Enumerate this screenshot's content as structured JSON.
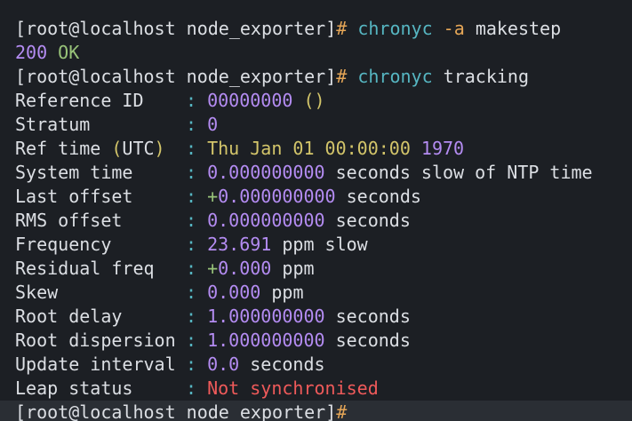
{
  "prompt1": {
    "user_host_dir": "[root@localhost node_exporter]",
    "hash": "#",
    "command": "chronyc",
    "flag": "-a",
    "arg": "makestep"
  },
  "output1": {
    "code": "200",
    "text": "OK"
  },
  "prompt2": {
    "user_host_dir": "[root@localhost node_exporter]",
    "hash": "#",
    "command": "chronyc",
    "arg": "tracking"
  },
  "separator": ":",
  "tracking": {
    "reference_id": {
      "label": "Reference ID",
      "value": "00000000",
      "extra": "()"
    },
    "stratum": {
      "label": "Stratum",
      "value": "0"
    },
    "ref_time": {
      "label_pre": "Ref time ",
      "label_paren_open": "(",
      "label_utc": "UTC",
      "label_paren_close": ")",
      "value_text": "Thu Jan 01 00:00:00",
      "value_year": "1970"
    },
    "system_time": {
      "label": "System time",
      "value": "0.000000000",
      "suffix": "seconds slow of NTP time"
    },
    "last_offset": {
      "label": "Last offset",
      "sign": "+",
      "value": "0.000000000",
      "suffix": "seconds"
    },
    "rms_offset": {
      "label": "RMS offset",
      "value": "0.000000000",
      "suffix": "seconds"
    },
    "frequency": {
      "label": "Frequency",
      "value": "23.691",
      "suffix": "ppm slow"
    },
    "residual_freq": {
      "label": "Residual freq",
      "sign": "+",
      "value": "0.000",
      "suffix": "ppm"
    },
    "skew": {
      "label": "Skew",
      "value": "0.000",
      "suffix": "ppm"
    },
    "root_delay": {
      "label": "Root delay",
      "value": "1.000000000",
      "suffix": "seconds"
    },
    "root_dispersion": {
      "label": "Root dispersion",
      "value": "1.000000000",
      "suffix": "seconds"
    },
    "update_interval": {
      "label": "Update interval",
      "value": "0.0",
      "suffix": "seconds"
    },
    "leap_status": {
      "label": "Leap status",
      "value": "Not synchronised"
    }
  },
  "prompt3": {
    "user_host_dir": "[root@localhost node_exporter]",
    "hash": "#"
  },
  "colors": {
    "background": "#1c1f24",
    "text": "#dcdfe4",
    "command": "#56b6c2",
    "number": "#b48cf2",
    "ok": "#98c379",
    "date": "#d3c56a",
    "error": "#ef5a5a",
    "prompt_hash": "#e5a657"
  }
}
